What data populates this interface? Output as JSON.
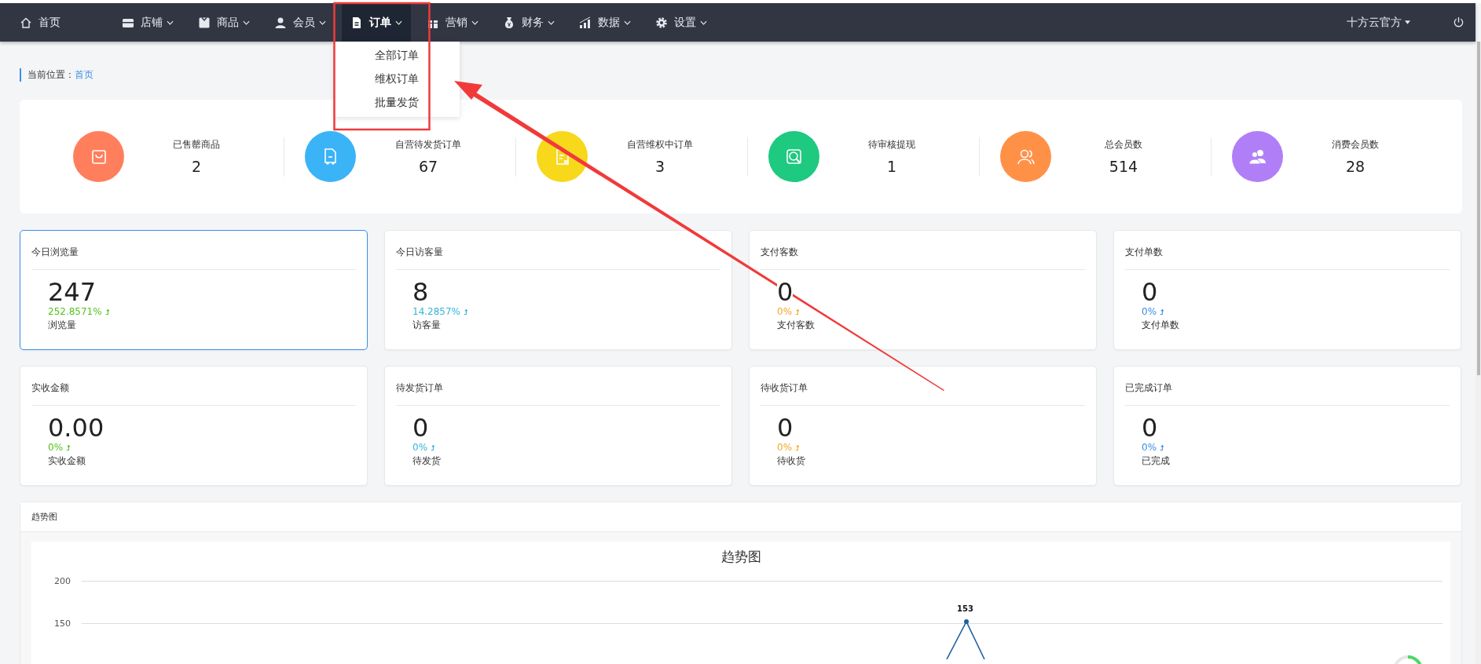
{
  "nav": {
    "items": [
      {
        "label": "首页",
        "kind": "home",
        "selected": false
      },
      {
        "label": "店铺",
        "kind": "store",
        "selected": false
      },
      {
        "label": "商品",
        "kind": "box",
        "selected": false
      },
      {
        "label": "会员",
        "kind": "user",
        "selected": false
      },
      {
        "label": "订单",
        "kind": "doc",
        "selected": true,
        "menu_items": [
          "全部订单",
          "维权订单",
          "批量发货"
        ]
      },
      {
        "label": "营销",
        "kind": "gift",
        "selected": false
      },
      {
        "label": "财务",
        "kind": "bag",
        "selected": false
      },
      {
        "label": "数据",
        "kind": "bars",
        "selected": false
      },
      {
        "label": "设置",
        "kind": "gear",
        "selected": false
      }
    ],
    "user": "十方云官方"
  },
  "breadcrumb": {
    "label": "当前位置：",
    "link": "首页"
  },
  "stats": [
    {
      "label": "已售罄商品",
      "value": "2",
      "color": "#ff7f5c",
      "kind": "bag"
    },
    {
      "label": "自营待发货订单",
      "value": "67",
      "color": "#3bb3f7",
      "kind": "truck"
    },
    {
      "label": "自营维权中订单",
      "value": "3",
      "color": "#f7d81b",
      "kind": "doc"
    },
    {
      "label": "待审核提现",
      "value": "1",
      "color": "#1ec980",
      "kind": "search"
    },
    {
      "label": "总会员数",
      "value": "514",
      "color": "#ff9147",
      "kind": "users"
    },
    {
      "label": "消费会员数",
      "value": "28",
      "color": "#b07ff7",
      "kind": "people"
    }
  ],
  "cards": [
    {
      "title": "今日浏览量",
      "value": "247",
      "rate": "252.8571%",
      "color": "#52c41a",
      "caption": "浏览量",
      "selected": true
    },
    {
      "title": "今日访客量",
      "value": "8",
      "rate": "14.2857%",
      "color": "#36b3d9",
      "caption": "访客量",
      "selected": false
    },
    {
      "title": "支付客数",
      "value": "0",
      "rate": "0%",
      "color": "#f5a623",
      "caption": "支付客数",
      "selected": false
    },
    {
      "title": "支付单数",
      "value": "0",
      "rate": "0%",
      "color": "#3a8ee6",
      "caption": "支付单数",
      "selected": false
    },
    {
      "title": "实收金额",
      "value": "0.00",
      "rate": "0%",
      "color": "#52c41a",
      "caption": "实收金额",
      "selected": false
    },
    {
      "title": "待发货订单",
      "value": "0",
      "rate": "0%",
      "color": "#36b3d9",
      "caption": "待发货",
      "selected": false
    },
    {
      "title": "待收货订单",
      "value": "0",
      "rate": "0%",
      "color": "#f5a623",
      "caption": "待收货",
      "selected": false
    },
    {
      "title": "已完成订单",
      "value": "0",
      "rate": "0%",
      "color": "#3a8ee6",
      "caption": "已完成",
      "selected": false
    }
  ],
  "trend": {
    "header": "趋势图",
    "title": "趋势图",
    "y_tick_labels": [
      "200",
      "150"
    ],
    "peak_label": "153"
  }
}
